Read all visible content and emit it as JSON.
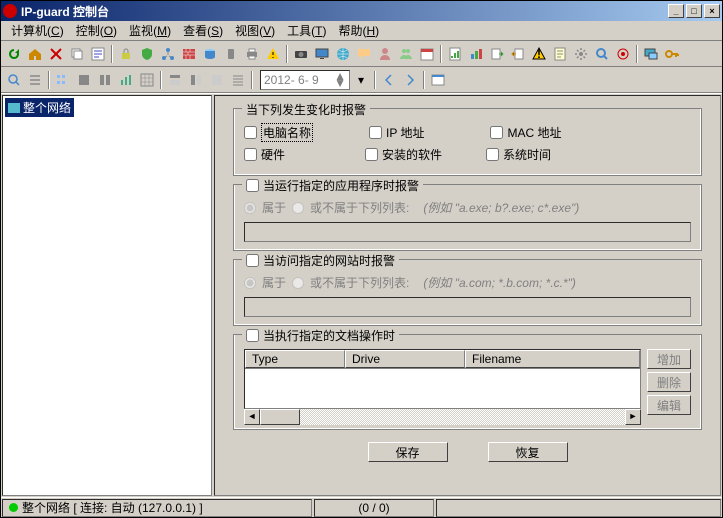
{
  "title": "IP-guard 控制台",
  "menu": {
    "computer": "计算机",
    "computer_u": "C",
    "control": "控制",
    "control_u": "O",
    "monitor": "监视",
    "monitor_u": "M",
    "query": "查看",
    "query_u": "S",
    "view": "视图",
    "view_u": "V",
    "tools": "工具",
    "tools_u": "T",
    "help": "帮助",
    "help_u": "H"
  },
  "date": "2012- 6- 9",
  "tree": {
    "root": "整个网络"
  },
  "group1": {
    "legend": "当下列发生变化时报警",
    "chk_pcname": "电脑名称",
    "chk_ip": "IP 地址",
    "chk_mac": "MAC 地址",
    "chk_hw": "硬件",
    "chk_sw": "安装的软件",
    "chk_time": "系统时间"
  },
  "group2": {
    "title": "当运行指定的应用程序时报警",
    "opt_in": "属于",
    "opt_notin": "或不属于下列列表:",
    "hint": "(例如 \"a.exe; b?.exe; c*.exe\")"
  },
  "group3": {
    "title": "当访问指定的网站时报警",
    "opt_in": "属于",
    "opt_notin": "或不属于下列列表:",
    "hint": "(例如 \"a.com; *.b.com; *.c.*\")"
  },
  "group4": {
    "title": "当执行指定的文档操作时",
    "col_type": "Type",
    "col_drive": "Drive",
    "col_file": "Filename",
    "btn_add": "增加",
    "btn_del": "删除",
    "btn_edit": "编辑"
  },
  "buttons": {
    "save": "保存",
    "restore": "恢复"
  },
  "status": {
    "conn": "整个网络 [ 连接: 自动 (127.0.0.1) ]",
    "count": "(0 / 0)"
  }
}
